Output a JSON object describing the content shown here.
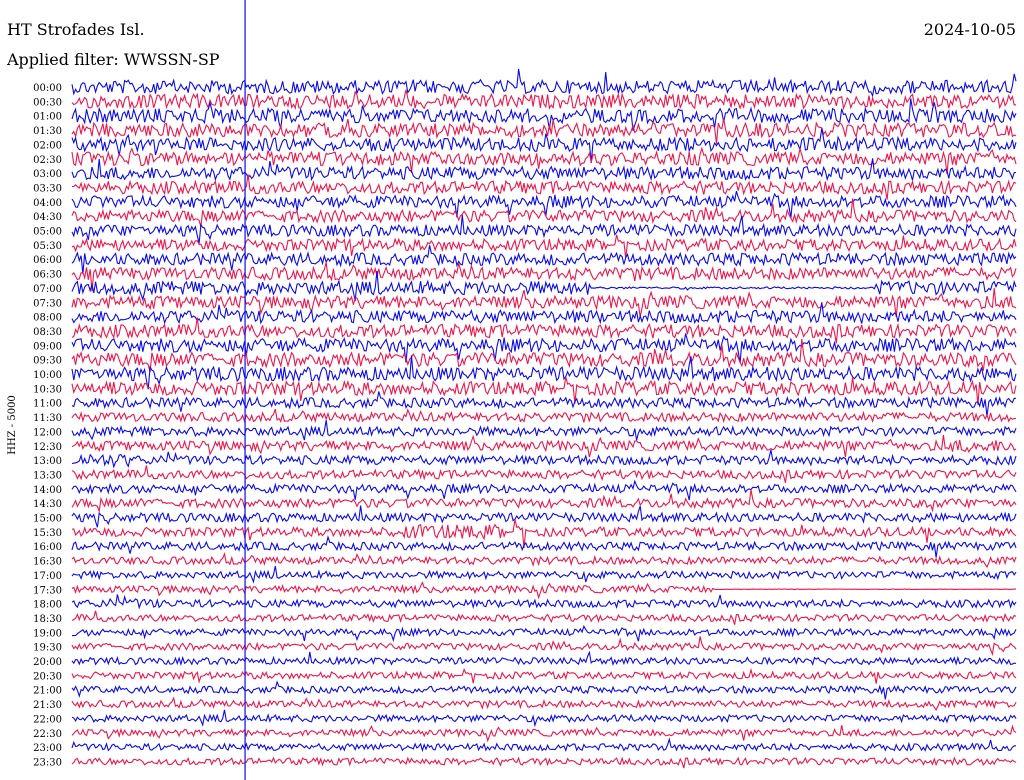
{
  "header": {
    "station": "HT Strofades Isl.",
    "date": "2024-10-05",
    "filter": "Applied filter: WWSSN-SP"
  },
  "chart_data": {
    "type": "helicorder",
    "title": "HT Strofades Isl.",
    "date": "2024-10-05",
    "filter": "WWSSN-SP",
    "ylabel": "HHZ - 5000",
    "trace_colors": [
      "#0a0aef",
      "#f0154a"
    ],
    "row_labels": [
      "00:00",
      "00:30",
      "01:00",
      "01:30",
      "02:00",
      "02:30",
      "03:00",
      "03:30",
      "04:00",
      "04:30",
      "05:00",
      "05:30",
      "06:00",
      "06:30",
      "07:00",
      "07:30",
      "08:00",
      "08:30",
      "09:00",
      "09:30",
      "10:00",
      "10:30",
      "11:00",
      "11:30",
      "12:00",
      "12:30",
      "13:00",
      "13:30",
      "14:00",
      "14:30",
      "15:00",
      "15:30",
      "16:00",
      "16:30",
      "17:00",
      "17:30",
      "18:00",
      "18:30",
      "19:00",
      "19:30",
      "20:00",
      "20:30",
      "21:00",
      "21:30",
      "22:00",
      "22:30",
      "23:00",
      "23:30"
    ],
    "noise_level": [
      0.75,
      0.78,
      0.8,
      0.78,
      0.76,
      0.75,
      0.72,
      0.7,
      0.68,
      0.66,
      0.65,
      0.65,
      0.68,
      0.7,
      0.75,
      0.72,
      0.7,
      0.72,
      0.75,
      0.78,
      0.78,
      0.75,
      0.55,
      0.5,
      0.5,
      0.55,
      0.5,
      0.48,
      0.48,
      0.5,
      0.5,
      0.5,
      0.45,
      0.42,
      0.4,
      0.4,
      0.42,
      0.38,
      0.38,
      0.38,
      0.38,
      0.38,
      0.38,
      0.38,
      0.38,
      0.38,
      0.38,
      0.38
    ],
    "events": [
      {
        "row": "07:00",
        "start": 0.55,
        "end": 0.85,
        "level": 0.15
      },
      {
        "row": "13:00",
        "start": 0.0,
        "end": 0.06,
        "level": 1.5
      },
      {
        "row": "15:30",
        "start": 0.35,
        "end": 0.48,
        "level": 1.6
      },
      {
        "row": "12:30",
        "start": 0.93,
        "end": 1.0,
        "level": 1.3
      },
      {
        "row": "17:30",
        "start": 0.68,
        "end": 1.0,
        "level": 0.05
      },
      {
        "row": "18:00",
        "start": 0.03,
        "end": 0.09,
        "level": 1.3
      }
    ],
    "marker_minute": 5.5,
    "minutes_per_row": 30
  }
}
